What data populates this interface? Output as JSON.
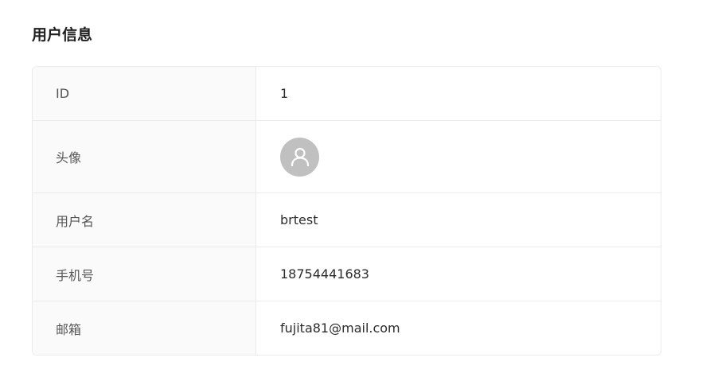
{
  "page": {
    "title": "用户信息"
  },
  "rows": [
    {
      "label": "ID",
      "value": "1"
    },
    {
      "label": "头像",
      "value": "",
      "icon": "user-avatar-icon"
    },
    {
      "label": "用户名",
      "value": "brtest"
    },
    {
      "label": "手机号",
      "value": "18754441683"
    },
    {
      "label": "邮箱",
      "value": "fujita81@mail.com"
    }
  ],
  "colors": {
    "label_bg": "#fafafa",
    "border": "#ebebeb",
    "avatar_bg": "#c0c0c0"
  }
}
